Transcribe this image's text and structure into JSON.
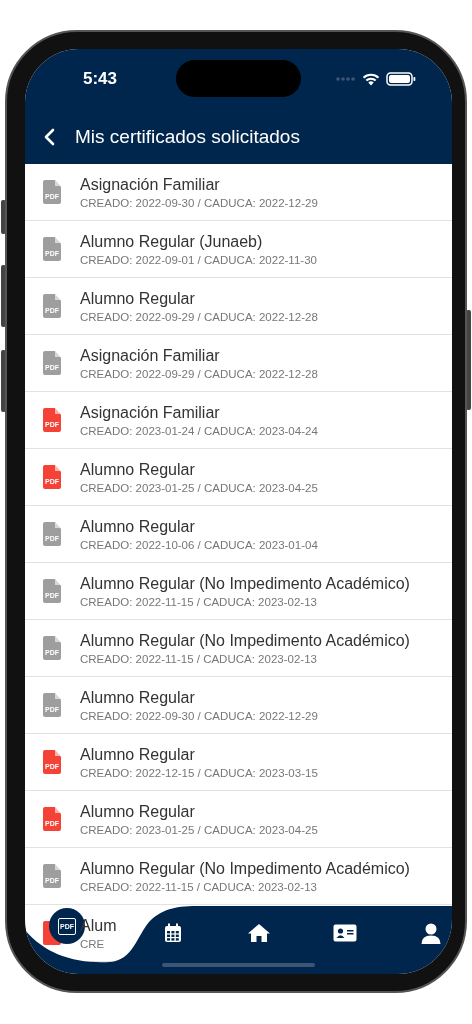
{
  "status_bar": {
    "time": "5:43"
  },
  "header": {
    "title": "Mis certificados solicitados"
  },
  "certificates": [
    {
      "title": "Asignación Familiar",
      "dates": "CREADO: 2022-09-30 / CADUCA: 2022-12-29",
      "icon_text": "PDF",
      "color": "#9e9e9e"
    },
    {
      "title": "Alumno Regular (Junaeb)",
      "dates": "CREADO: 2022-09-01 / CADUCA: 2022-11-30",
      "icon_text": "PDF",
      "color": "#9e9e9e"
    },
    {
      "title": "Alumno Regular",
      "dates": "CREADO: 2022-09-29 / CADUCA: 2022-12-28",
      "icon_text": "PDF",
      "color": "#9e9e9e"
    },
    {
      "title": "Asignación Familiar",
      "dates": "CREADO: 2022-09-29 / CADUCA: 2022-12-28",
      "icon_text": "PDF",
      "color": "#9e9e9e"
    },
    {
      "title": "Asignación Familiar",
      "dates": "CREADO: 2023-01-24 / CADUCA: 2023-04-24",
      "icon_text": "PDF",
      "color": "#f44336"
    },
    {
      "title": "Alumno Regular",
      "dates": "CREADO: 2023-01-25 / CADUCA: 2023-04-25",
      "icon_text": "PDF",
      "color": "#f44336"
    },
    {
      "title": "Alumno Regular",
      "dates": "CREADO: 2022-10-06 / CADUCA: 2023-01-04",
      "icon_text": "PDF",
      "color": "#9e9e9e"
    },
    {
      "title": "Alumno Regular (No Impedimento Académico)",
      "dates": "CREADO: 2022-11-15 / CADUCA: 2023-02-13",
      "icon_text": "PDF",
      "color": "#9e9e9e"
    },
    {
      "title": "Alumno Regular (No Impedimento Académico)",
      "dates": "CREADO: 2022-11-15 / CADUCA: 2023-02-13",
      "icon_text": "PDF",
      "color": "#9e9e9e"
    },
    {
      "title": "Alumno Regular",
      "dates": "CREADO: 2022-09-30 / CADUCA: 2022-12-29",
      "icon_text": "PDF",
      "color": "#9e9e9e"
    },
    {
      "title": "Alumno Regular",
      "dates": "CREADO: 2022-12-15 / CADUCA: 2023-03-15",
      "icon_text": "PDF",
      "color": "#f44336"
    },
    {
      "title": "Alumno Regular",
      "dates": "CREADO: 2023-01-25 / CADUCA: 2023-04-25",
      "icon_text": "PDF",
      "color": "#f44336"
    },
    {
      "title": "Alumno Regular (No Impedimento Académico)",
      "dates": "CREADO: 2022-11-15 / CADUCA: 2023-02-13",
      "icon_text": "PDF",
      "color": "#9e9e9e"
    },
    {
      "title": "Alum",
      "dates": "CRE",
      "color": "#f44336"
    }
  ],
  "tab_bar": {
    "fab_text": "PDF",
    "tabs": [
      {
        "kind": "calendar"
      },
      {
        "kind": "home"
      },
      {
        "kind": "id_card"
      },
      {
        "kind": "user"
      }
    ]
  }
}
